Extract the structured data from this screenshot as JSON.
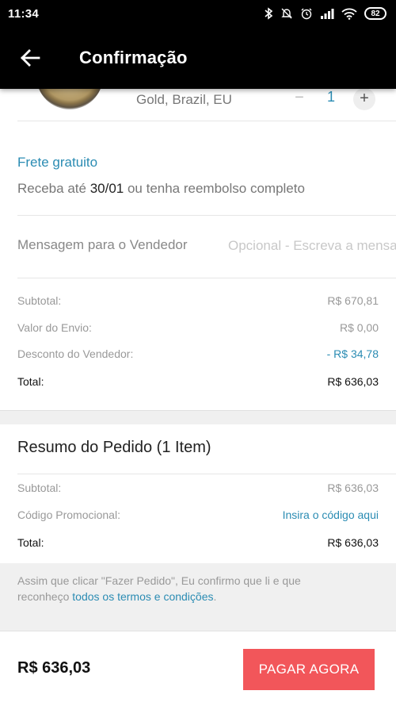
{
  "status_bar": {
    "time": "11:34",
    "battery": "82"
  },
  "app_bar": {
    "title": "Confirmação"
  },
  "product": {
    "variant": "Gold, Brazil, EU",
    "qty_minus": "−",
    "quantity": "1",
    "qty_plus": "+"
  },
  "shipping": {
    "title": "Frete gratuito",
    "desc_prefix": "Receba até ",
    "desc_date": "30/01",
    "desc_suffix": " ou tenha reembolso completo"
  },
  "message": {
    "label": "Mensagem para o Vendedor",
    "placeholder": "Opcional - Escreva a mensagem"
  },
  "seller_summary": {
    "subtotal_label": "Subtotal:",
    "subtotal_value": "R$ 670,81",
    "shipping_label": "Valor do Envio:",
    "shipping_value": "R$ 0,00",
    "discount_label": "Desconto do Vendedor:",
    "discount_value": "- R$ 34,78",
    "total_label": "Total:",
    "total_value": "R$ 636,03"
  },
  "order_summary": {
    "title": "Resumo do Pedido (1 Item)",
    "subtotal_label": "Subtotal:",
    "subtotal_value": "R$ 636,03",
    "promo_label": "Código Promocional:",
    "promo_link": "Insira o código aqui",
    "total_label": "Total:",
    "total_value": "R$ 636,03"
  },
  "terms": {
    "text_line1": "Assim que clicar \"Fazer Pedido\", Eu confirmo que li e que",
    "text_line2_prefix": "reconheço ",
    "link": "todos os termos e condições",
    "text_line2_suffix": "."
  },
  "footer": {
    "total": "R$ 636,03",
    "pay_button": "PAGAR AGORA"
  },
  "colors": {
    "accent_blue": "#2b8cb3",
    "pay_red": "#f2565a"
  }
}
